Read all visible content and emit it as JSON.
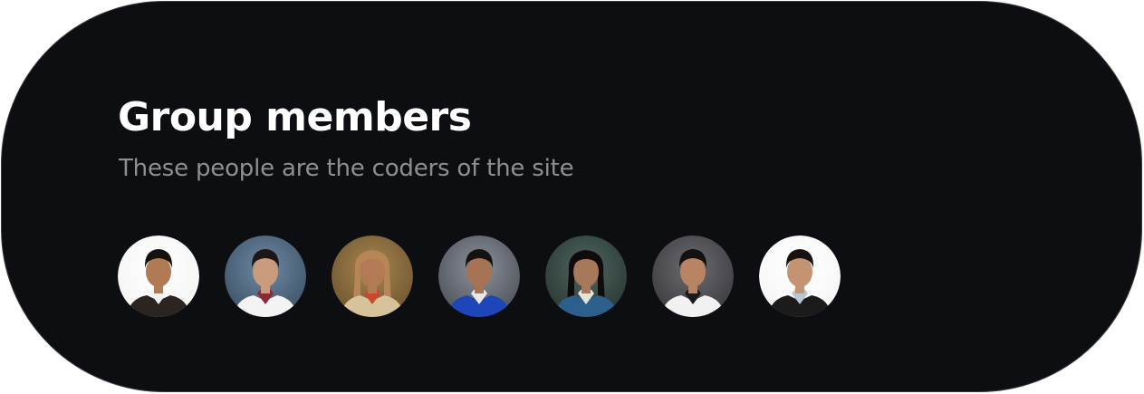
{
  "section": {
    "title": "Group members",
    "subtitle": "These people are the coders of the site"
  },
  "members": [
    {
      "bg": "#ffffff",
      "bg2": "#f4f4f4",
      "skin": "#b07a55",
      "hair": "#15110e",
      "clothes": "#2b2420",
      "accent": "#f1f1f1",
      "hairStyle": "short"
    },
    {
      "bg": "#6f8aa5",
      "bg2": "#3d5266",
      "skin": "#c99a7c",
      "hair": "#1c1716",
      "clothes": "#f3f3f3",
      "accent": "#8a2a34",
      "hairStyle": "short"
    },
    {
      "bg": "#a8864e",
      "bg2": "#6e5531",
      "skin": "#b27a55",
      "hair": "#b68656",
      "clothes": "#d7c39a",
      "accent": "#c84a2c",
      "hairStyle": "long"
    },
    {
      "bg": "#8c919b",
      "bg2": "#4e525a",
      "skin": "#a67454",
      "hair": "#141212",
      "clothes": "#1f46b8",
      "accent": "#e8e8e8",
      "hairStyle": "short"
    },
    {
      "bg": "#4f6660",
      "bg2": "#2a3834",
      "skin": "#a8785a",
      "hair": "#0f0c0b",
      "clothes": "#2d5f8c",
      "accent": "#e6e4d6",
      "hairStyle": "long"
    },
    {
      "bg": "#6d6c71",
      "bg2": "#3b3a3f",
      "skin": "#b88463",
      "hair": "#141110",
      "clothes": "#f1f1f1",
      "accent": "#1a1a1a",
      "hairStyle": "short"
    },
    {
      "bg": "#ffffff",
      "bg2": "#f6f6f6",
      "skin": "#c49372",
      "hair": "#17120f",
      "clothes": "#1b1b1b",
      "accent": "#b9c7d2",
      "hairStyle": "short"
    }
  ]
}
